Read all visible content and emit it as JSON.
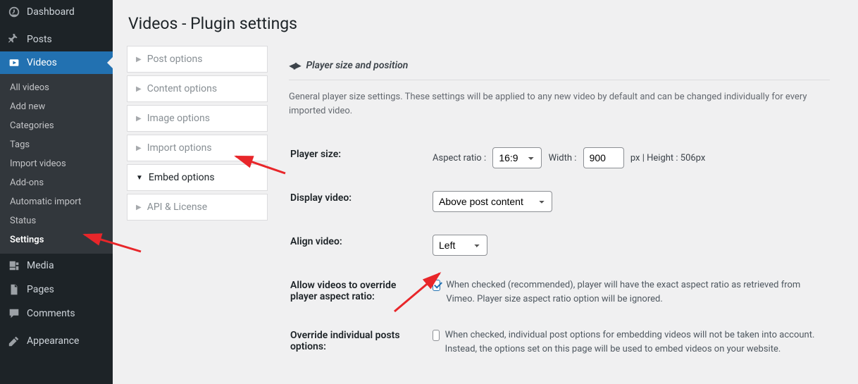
{
  "sidebar": {
    "dashboard": "Dashboard",
    "posts": "Posts",
    "videos": "Videos",
    "submenu": {
      "all_videos": "All videos",
      "add_new": "Add new",
      "categories": "Categories",
      "tags": "Tags",
      "import_videos": "Import videos",
      "addons": "Add-ons",
      "automatic_import": "Automatic import",
      "status": "Status",
      "settings": "Settings"
    },
    "media": "Media",
    "pages": "Pages",
    "comments": "Comments",
    "appearance": "Appearance"
  },
  "page": {
    "title": "Videos - Plugin settings"
  },
  "tabs": {
    "post_options": "Post options",
    "content_options": "Content options",
    "image_options": "Image options",
    "import_options": "Import options",
    "embed_options": "Embed options",
    "api_license": "API & License"
  },
  "section": {
    "title": "Player size and position",
    "description": "General player size settings. These settings will be applied to any new video by default and can be changed individually for every imported video."
  },
  "fields": {
    "player_size": {
      "label": "Player size:",
      "aspect_label": "Aspect ratio :",
      "aspect_value": "16:9",
      "width_label": "Width :",
      "width_value": "900",
      "height_label": "px | Height : 506px"
    },
    "display_video": {
      "label": "Display video:",
      "value": "Above post content"
    },
    "align_video": {
      "label": "Align video:",
      "value": "Left"
    },
    "override_aspect": {
      "label": "Allow videos to override player aspect ratio:",
      "checked": true,
      "desc": "When checked (recommended), player will have the exact aspect ratio as retrieved from Vimeo. Player size aspect ratio option will be ignored."
    },
    "override_posts": {
      "label": "Override individual posts options:",
      "checked": false,
      "desc": "When checked, individual post options for embedding videos will not be taken into account. Instead, the options set on this page will be used to embed videos on your website."
    }
  }
}
